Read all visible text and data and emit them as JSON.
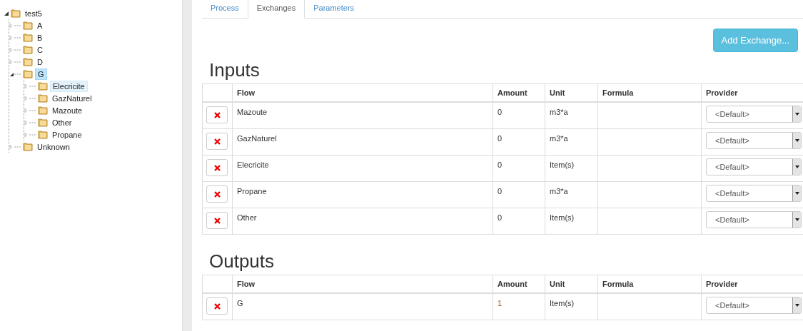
{
  "tree": {
    "label": "test5",
    "expanded": true,
    "selected": false,
    "hovered": false,
    "children": [
      {
        "label": "A",
        "expanded": false,
        "selected": false,
        "hovered": false
      },
      {
        "label": "B",
        "expanded": false,
        "selected": false,
        "hovered": false
      },
      {
        "label": "C",
        "expanded": false,
        "selected": false,
        "hovered": false
      },
      {
        "label": "D",
        "expanded": false,
        "selected": false,
        "hovered": false
      },
      {
        "label": "G",
        "expanded": true,
        "selected": true,
        "hovered": false,
        "children": [
          {
            "label": "Elecricite",
            "expanded": false,
            "selected": false,
            "hovered": true
          },
          {
            "label": "GazNaturel",
            "expanded": false,
            "selected": false,
            "hovered": false
          },
          {
            "label": "Mazoute",
            "expanded": false,
            "selected": false,
            "hovered": false
          },
          {
            "label": "Other",
            "expanded": false,
            "selected": false,
            "hovered": false
          },
          {
            "label": "Propane",
            "expanded": false,
            "selected": false,
            "hovered": false
          }
        ]
      },
      {
        "label": "Unknown",
        "expanded": false,
        "selected": false,
        "hovered": false
      }
    ]
  },
  "tabs": [
    {
      "label": "Process",
      "selected": false
    },
    {
      "label": "Exchanges",
      "selected": true
    },
    {
      "label": "Parameters",
      "selected": false
    }
  ],
  "add_button": "Add Exchange...",
  "sections": [
    {
      "title": "Inputs",
      "columns": [
        "Flow",
        "Amount",
        "Unit",
        "Formula",
        "Provider"
      ],
      "rows": [
        {
          "flow": "Mazoute",
          "amount": "0",
          "unit": "m3*a",
          "provider": "<Default>"
        },
        {
          "flow": "GazNaturel",
          "amount": "0",
          "unit": "m3*a",
          "provider": "<Default>"
        },
        {
          "flow": "Elecricite",
          "amount": "0",
          "unit": "Item(s)",
          "provider": "<Default>"
        },
        {
          "flow": "Propane",
          "amount": "0",
          "unit": "m3*a",
          "provider": "<Default>"
        },
        {
          "flow": "Other",
          "amount": "0",
          "unit": "Item(s)",
          "provider": "<Default>"
        }
      ]
    },
    {
      "title": "Outputs",
      "columns": [
        "Flow",
        "Amount",
        "Unit",
        "Formula",
        "Provider"
      ],
      "rows": [
        {
          "flow": "G",
          "amount": "1",
          "unit": "Item(s)",
          "provider": "<Default>"
        }
      ]
    }
  ]
}
